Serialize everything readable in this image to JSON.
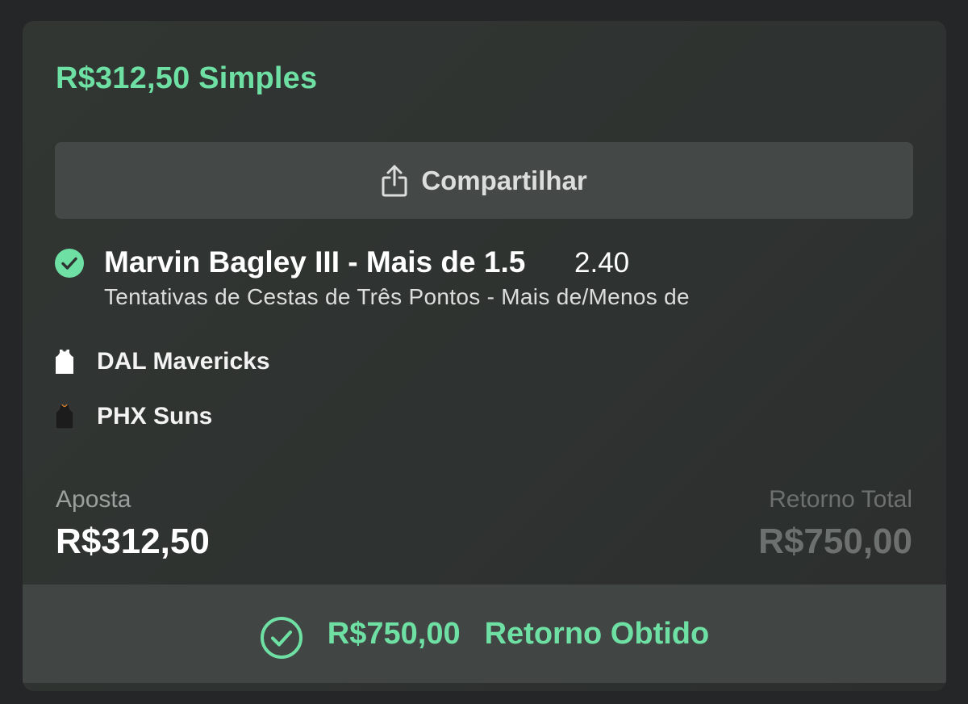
{
  "bet": {
    "header_title": "R$312,50 Simples",
    "share_label": "Compartilhar",
    "selection": {
      "name": "Marvin Bagley III - Mais de 1.5",
      "odds": "2.40",
      "market": "Tentativas de Cestas de Três Pontos - Mais de/Menos de"
    },
    "teams": [
      {
        "name": "DAL Mavericks",
        "jersey_color": "#ffffff"
      },
      {
        "name": "PHX Suns",
        "jersey_color": "#1c1c1c"
      }
    ],
    "stake": {
      "label": "Aposta",
      "value": "R$312,50"
    },
    "total_return": {
      "label": "Retorno Total",
      "value": "R$750,00"
    },
    "result": {
      "amount": "R$750,00",
      "status": "Retorno Obtido"
    }
  },
  "colors": {
    "accent_green": "#6ee0a4",
    "card_bg": "#2e3230",
    "page_bg": "#252627"
  },
  "icons": {
    "share": "share-icon",
    "check": "check-circle-icon",
    "jersey": "jersey-icon"
  }
}
